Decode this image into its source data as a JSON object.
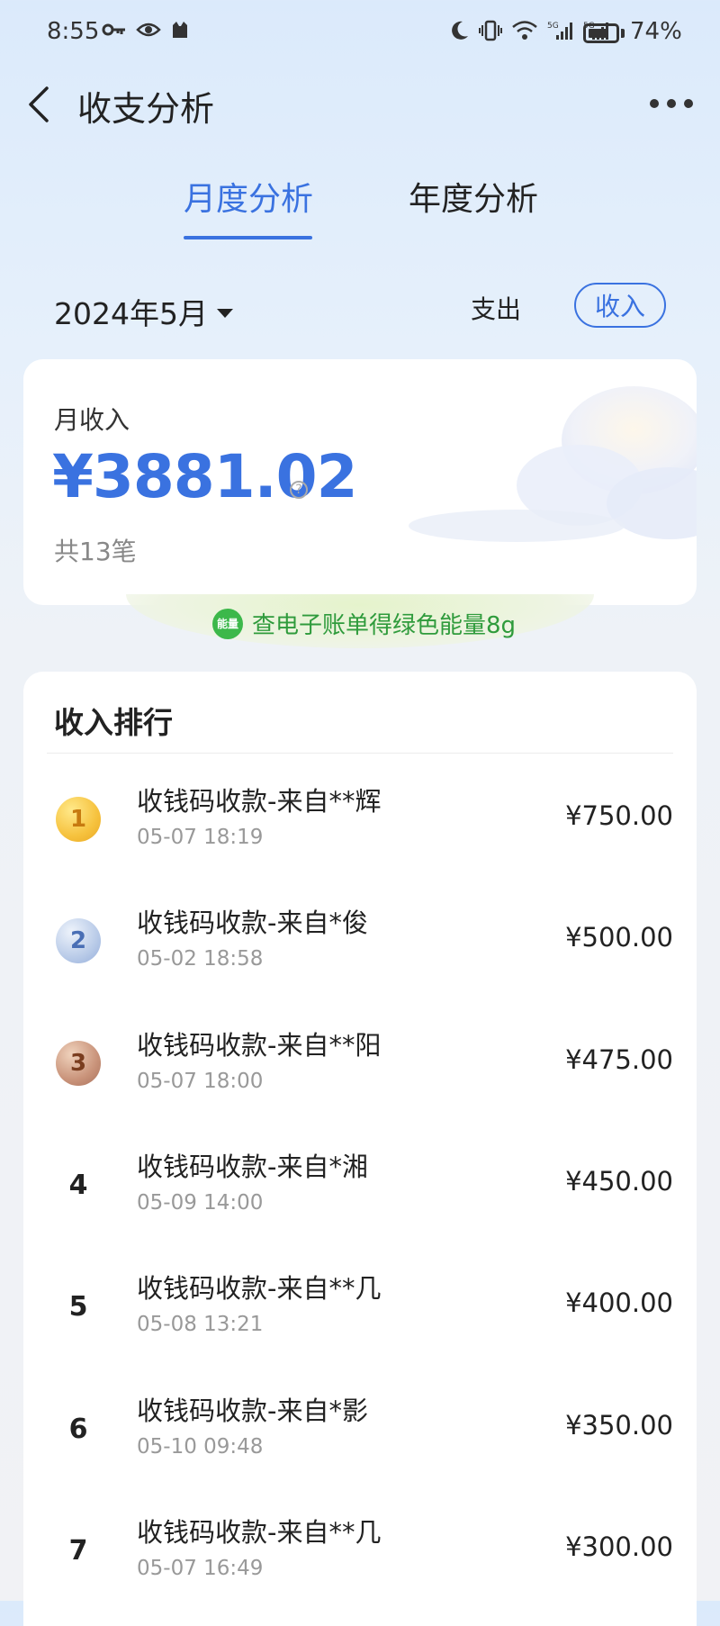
{
  "status_bar": {
    "time": "8:55",
    "battery_percent": "74%",
    "battery_level": 0.74,
    "icons_left": [
      "key-icon",
      "eye-icon",
      "cat-icon"
    ],
    "icons_right": [
      "moon-icon",
      "vibrate-icon",
      "wifi-icon",
      "signal-5g-icon",
      "signal-5g-icon"
    ],
    "signal_label": "5G"
  },
  "header": {
    "title": "收支分析"
  },
  "tabs": [
    {
      "label": "月度分析",
      "active": true
    },
    {
      "label": "年度分析",
      "active": false
    }
  ],
  "filters": {
    "month": "2024年5月",
    "expense_label": "支出",
    "income_label": "收入",
    "selected": "income"
  },
  "summary": {
    "label": "月收入",
    "amount": "¥3881.02",
    "count": "共13笔",
    "help_glyph": "?"
  },
  "energy_banner": {
    "icon_text": "能量",
    "text": "查电子账单得绿色能量8g"
  },
  "ranking": {
    "title": "收入排行",
    "items": [
      {
        "rank": "1",
        "name": "收钱码收款-来自**辉",
        "time": "05-07 18:19",
        "amount": "¥750.00"
      },
      {
        "rank": "2",
        "name": "收钱码收款-来自*俊",
        "time": "05-02 18:58",
        "amount": "¥500.00"
      },
      {
        "rank": "3",
        "name": "收钱码收款-来自**阳",
        "time": "05-07 18:00",
        "amount": "¥475.00"
      },
      {
        "rank": "4",
        "name": "收钱码收款-来自*湘",
        "time": "05-09 14:00",
        "amount": "¥450.00"
      },
      {
        "rank": "5",
        "name": "收钱码收款-来自**几",
        "time": "05-08 13:21",
        "amount": "¥400.00"
      },
      {
        "rank": "6",
        "name": "收钱码收款-来自*影",
        "time": "05-10 09:48",
        "amount": "¥350.00"
      },
      {
        "rank": "7",
        "name": "收钱码收款-来自**几",
        "time": "05-07 16:49",
        "amount": "¥300.00"
      }
    ]
  },
  "colors": {
    "accent": "#3a72e0",
    "energy_green": "#2f9b3c"
  }
}
